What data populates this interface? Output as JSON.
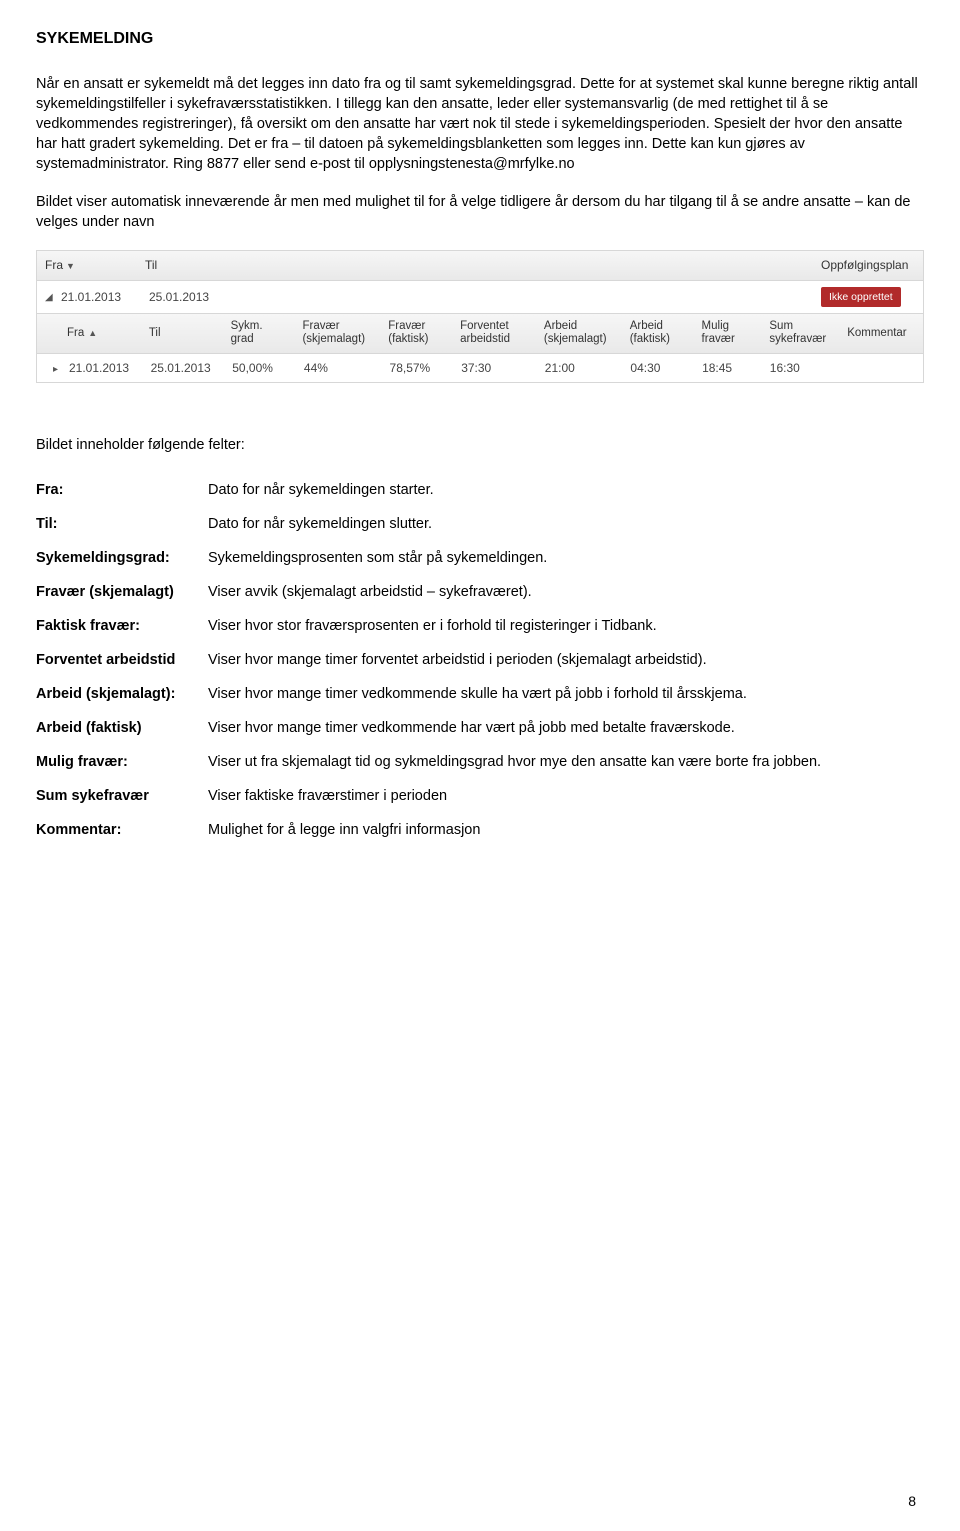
{
  "heading": "SYKEMELDING",
  "para1": "Når en ansatt er sykemeldt må det legges inn dato fra og til samt sykemeldingsgrad. Dette for at systemet skal kunne beregne riktig antall sykemeldingstilfeller i sykefraværsstatistikken. I tillegg kan den ansatte, leder eller systemansvarlig (de med rettighet til å se vedkommendes registreringer), få oversikt om den ansatte har vært nok til stede i sykemeldingsperioden. Spesielt der hvor den ansatte har hatt gradert sykemelding. Det er fra – til datoen på sykemeldingsblanketten som legges inn. Dette kan kun gjøres av systemadministrator. Ring 8877 eller send e-post til opplysningstenesta@mrfylke.no",
  "para2": "Bildet viser automatisk inneværende år men med mulighet til for å velge tidligere år dersom du har tilgang til å se andre ansatte – kan de velges under navn",
  "topHeader": {
    "fra": "Fra",
    "til": "Til",
    "opp": "Oppfølgingsplan"
  },
  "topRow": {
    "fra": "21.01.2013",
    "til": "25.01.2013",
    "badge": "Ikke opprettet"
  },
  "subHeader": {
    "fra": "Fra",
    "til": "Til",
    "sykm": "Sykm. grad",
    "frav1": "Fravær (skjemalagt)",
    "frav2": "Fravær (faktisk)",
    "forv": "Forventet arbeidstid",
    "arb1": "Arbeid (skjemalagt)",
    "arb2": "Arbeid (faktisk)",
    "mulig": "Mulig fravær",
    "sum": "Sum sykefravær",
    "komm": "Kommentar"
  },
  "subRow": {
    "fra": "21.01.2013",
    "til": "25.01.2013",
    "sykm": "50,00%",
    "frav1": "44%",
    "frav2": "78,57%",
    "forv": "37:30",
    "arb1": "21:00",
    "arb2": "04:30",
    "mulig": "18:45",
    "sum": "16:30"
  },
  "felterHeading": "Bildet inneholder følgende felter:",
  "defs": [
    {
      "k": "Fra:",
      "v": "Dato for når sykemeldingen starter."
    },
    {
      "k": "Til:",
      "v": "Dato for når sykemeldingen slutter."
    },
    {
      "k": "Sykemeldingsgrad:",
      "v": "Sykemeldingsprosenten som står på sykemeldingen."
    },
    {
      "k": "Fravær (skjemalagt)",
      "v": "Viser avvik (skjemalagt arbeidstid – sykefraværet)."
    },
    {
      "k": "Faktisk fravær:",
      "v": "Viser hvor stor fraværsprosenten er i forhold til registeringer i Tidbank."
    },
    {
      "k": "Forventet arbeidstid",
      "v": "Viser hvor mange timer forventet arbeidstid i perioden (skjemalagt arbeidstid)."
    },
    {
      "k": "Arbeid (skjemalagt):",
      "v": "Viser hvor mange timer vedkommende skulle ha vært på jobb i forhold til årsskjema."
    },
    {
      "k": "Arbeid (faktisk)",
      "v": "Viser hvor mange timer vedkommende har vært på jobb med betalte fraværskode."
    },
    {
      "k": "Mulig fravær:",
      "v": "Viser ut fra skjemalagt tid og sykmeldingsgrad hvor mye den ansatte kan være borte fra jobben."
    },
    {
      "k": "Sum sykefravær",
      "v": "Viser faktiske fraværstimer i perioden"
    },
    {
      "k": "Kommentar:",
      "v": "Mulighet for å legge inn valgfri informasjon"
    }
  ],
  "pageNumber": "8"
}
